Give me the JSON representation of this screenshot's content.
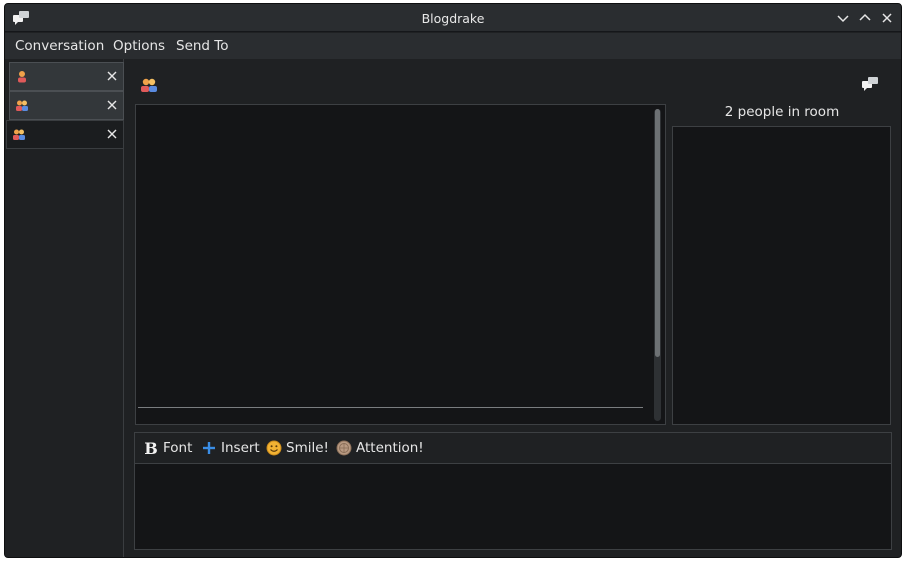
{
  "window": {
    "title": "Blogdrake"
  },
  "menu": {
    "items": [
      "Conversation",
      "Options",
      "Send To"
    ]
  },
  "tabs": [
    {
      "icon": "user-icon",
      "close_label": "✕"
    },
    {
      "icon": "group-icon",
      "close_label": "✕"
    },
    {
      "icon": "group-icon",
      "close_label": "✕",
      "active": true
    }
  ],
  "room": {
    "people_count_label": "2 people in room"
  },
  "toolbar": {
    "font_label": "Font",
    "insert_label": "Insert",
    "smile_label": "Smile!",
    "attention_label": "Attention!"
  },
  "colors": {
    "window_bg": "#1f2123",
    "titlebar_bg": "#2a2d30",
    "field_bg": "#141517",
    "accent_blue": "#3a8ee6",
    "smile_yellow": "#f2b233"
  }
}
